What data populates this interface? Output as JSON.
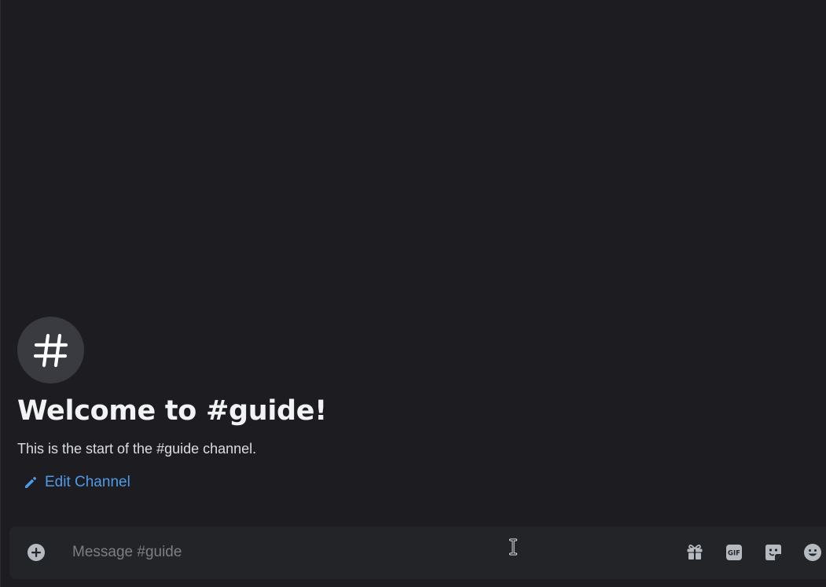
{
  "welcome": {
    "title": "Welcome to #guide!",
    "subtitle": "This is the start of the #guide channel.",
    "edit_label": "Edit Channel"
  },
  "composer": {
    "placeholder": "Message #guide",
    "value": ""
  },
  "icons": {
    "channel": "hash-icon",
    "edit": "pencil-icon",
    "add": "plus-circle-icon",
    "gift": "gift-icon",
    "gif": "gif-icon",
    "sticker": "sticker-icon",
    "emoji": "emoji-icon"
  },
  "colors": {
    "background": "#1c1c21",
    "composer": "#232428",
    "accent_link": "#4f9be8",
    "icon": "#b5bac1",
    "text": "#f2f3f5"
  }
}
